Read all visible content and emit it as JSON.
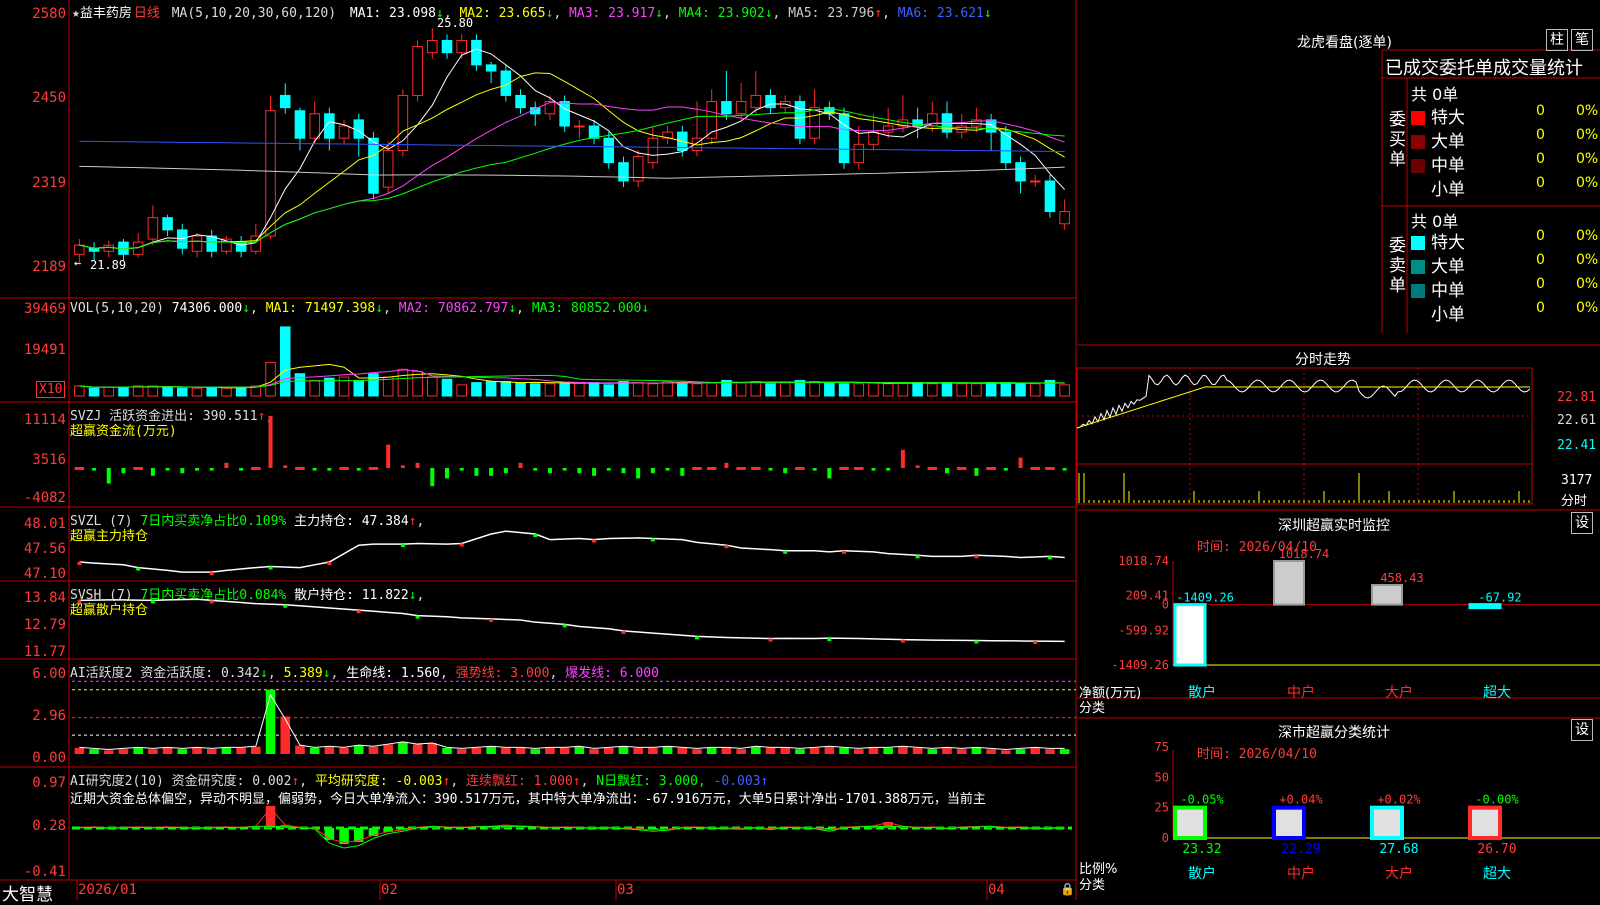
{
  "header": {
    "title": "益丰药房",
    "period": "日线",
    "ma_label": "MA(5,10,20,30,60,120)",
    "ma1": "MA1: 23.098",
    "ma2": "MA2: 23.665",
    "ma3": "MA3: 23.917",
    "ma4": "MA4: 23.902",
    "ma5": "MA5: 23.796",
    "ma6": "MA6: 23.621",
    "high_tag": "25.80",
    "low_tag": "21.89"
  },
  "price_axis": [
    "2580",
    "2450",
    "2319",
    "2189"
  ],
  "vol": {
    "label": "VOL(5,10,20)",
    "value": "74306.000",
    "ma1": "MA1: 71497.398",
    "ma2": "MA2: 70862.797",
    "ma3": "MA3: 80852.000",
    "axis": [
      "39469",
      "19491"
    ],
    "unit": "X10"
  },
  "svzj": {
    "label": "SVZJ  活跃资金进出: 390.511",
    "sub": "超赢资金流(万元)",
    "axis": [
      "11114",
      "3516",
      "-4082"
    ]
  },
  "svzl": {
    "label": "SVZL (7)",
    "ratio": "7日内买卖净占比0.109%",
    "hold": "主力持仓: 47.384",
    "sub": "超赢主力持仓",
    "axis": [
      "48.01",
      "47.56",
      "47.10"
    ]
  },
  "svsh": {
    "label": "SVSH (7)",
    "ratio": "7日内买卖净占比0.084%",
    "hold": "散户持仓: 11.822",
    "sub": "超赢散户持仓",
    "axis": [
      "13.84",
      "12.79",
      "11.77"
    ]
  },
  "ai1": {
    "label": "AI活跃度2 资金活跃度: 0.342",
    "v2": "5.389",
    "life": "生命线: 1.560",
    "strong": "强势线: 3.000",
    "burst": "爆发线: 6.000",
    "axis": [
      "6.00",
      "2.96",
      "0.00"
    ]
  },
  "ai2": {
    "label": "AI研究度2(10) 资金研究度: 0.002",
    "avg": "平均研究度: -0.003",
    "streak": "连续飘红: 1.000",
    "nday": "N日飘红: 3.000,",
    "neg": "-0.003",
    "comment": "近期大资金总体偏空，异动不明显，偏弱势，今日大单净流入：390.517万元，其中特大单净流出：-67.916万元，大单5日累计净出-1701.388万元，当前主",
    "axis": [
      "0.97",
      "0.28",
      "-0.41"
    ]
  },
  "date_axis": [
    "2026/01",
    "02",
    "03",
    "04"
  ],
  "brand": "大智慧",
  "dragon": {
    "title": "龙虎看盘(逐单)",
    "btn1": "柱",
    "btn2": "笔",
    "subtitle": "已成交委托单成交量统计",
    "buy_side": "委买单",
    "sell_side": "委卖单",
    "buy_total": "共 0单",
    "sell_total": "共 0单",
    "buy_rows": [
      {
        "name": "特大",
        "count": "0",
        "pct": "0%",
        "color": "#ff0000"
      },
      {
        "name": "大单",
        "count": "0",
        "pct": "0%",
        "color": "#8b0000"
      },
      {
        "name": "中单",
        "count": "0",
        "pct": "0%",
        "color": "#6b0000"
      },
      {
        "name": "小单",
        "count": "0",
        "pct": "0%",
        "color": ""
      }
    ],
    "sell_rows": [
      {
        "name": "特大",
        "count": "0",
        "pct": "0%",
        "color": "#00ffff"
      },
      {
        "name": "大单",
        "count": "0",
        "pct": "0%",
        "color": "#008b8b"
      },
      {
        "name": "中单",
        "count": "0",
        "pct": "0%",
        "color": "#007a7a"
      },
      {
        "name": "小单",
        "count": "0",
        "pct": "0%",
        "color": ""
      }
    ]
  },
  "intraday": {
    "title": "分时走势",
    "axis": [
      "22.81",
      "22.61",
      "22.41"
    ],
    "vol_axis": "3177",
    "vol_unit": "分时"
  },
  "sz_monitor": {
    "title": "深圳超赢实时监控",
    "btn": "设",
    "time": "时间: 2026/04/10",
    "axis": [
      "1018.74",
      "209.41",
      "0",
      "-599.92",
      "-1409.26"
    ],
    "ylabel": "净额(万元)",
    "xlabel": "分类",
    "bars": [
      {
        "cat": "散户",
        "value": "-1409.26"
      },
      {
        "cat": "中户",
        "value": "1018.74"
      },
      {
        "cat": "大户",
        "value": "458.43"
      },
      {
        "cat": "超大",
        "value": "-67.92"
      }
    ]
  },
  "sz_class": {
    "title": "深市超赢分类统计",
    "btn": "设",
    "time": "时间: 2026/04/10",
    "axis": [
      "75",
      "50",
      "25",
      "0"
    ],
    "ylabel": "比例%",
    "xlabel": "分类",
    "bars": [
      {
        "cat": "散户",
        "pct": "-0.05%",
        "value": "23.32"
      },
      {
        "cat": "中户",
        "pct": "+0.04%",
        "value": "22.29"
      },
      {
        "cat": "大户",
        "pct": "+0.02%",
        "value": "27.68"
      },
      {
        "cat": "超大",
        "pct": "-0.00%",
        "value": "26.70"
      }
    ]
  }
}
